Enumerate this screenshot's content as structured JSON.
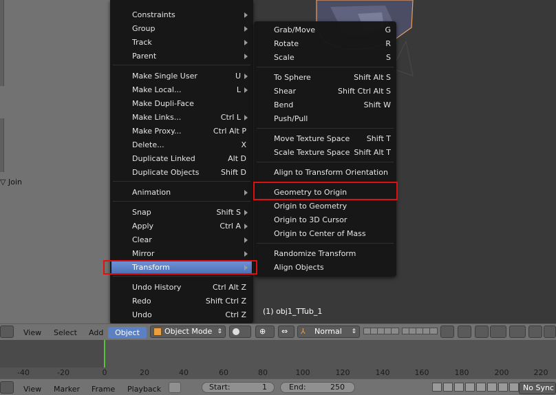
{
  "left_panel": {
    "join_label": "Join"
  },
  "object_menu": {
    "items": [
      {
        "label": "Constraints",
        "shortcut": "",
        "submenu": true
      },
      {
        "label": "Group",
        "shortcut": "",
        "submenu": true
      },
      {
        "label": "Track",
        "shortcut": "",
        "submenu": true
      },
      {
        "label": "Parent",
        "shortcut": "",
        "submenu": true
      },
      {
        "label": "Make Single User",
        "shortcut": "U",
        "submenu": true
      },
      {
        "label": "Make Local...",
        "shortcut": "L",
        "submenu": true
      },
      {
        "label": "Make Dupli-Face",
        "shortcut": "",
        "submenu": false
      },
      {
        "label": "Make Links...",
        "shortcut": "Ctrl L",
        "submenu": true
      },
      {
        "label": "Make Proxy...",
        "shortcut": "Ctrl Alt P",
        "submenu": false
      },
      {
        "label": "Delete...",
        "shortcut": "X",
        "submenu": false
      },
      {
        "label": "Duplicate Linked",
        "shortcut": "Alt D",
        "submenu": false
      },
      {
        "label": "Duplicate Objects",
        "shortcut": "Shift D",
        "submenu": false
      },
      {
        "label": "Animation",
        "shortcut": "",
        "submenu": true
      },
      {
        "label": "Snap",
        "shortcut": "Shift S",
        "submenu": true
      },
      {
        "label": "Apply",
        "shortcut": "Ctrl A",
        "submenu": true
      },
      {
        "label": "Clear",
        "shortcut": "",
        "submenu": true
      },
      {
        "label": "Mirror",
        "shortcut": "",
        "submenu": true
      },
      {
        "label": "Transform",
        "shortcut": "",
        "submenu": true
      },
      {
        "label": "Undo History",
        "shortcut": "Ctrl Alt Z",
        "submenu": false
      },
      {
        "label": "Redo",
        "shortcut": "Shift Ctrl Z",
        "submenu": false
      },
      {
        "label": "Undo",
        "shortcut": "Ctrl Z",
        "submenu": false
      }
    ]
  },
  "transform_menu": {
    "items": [
      {
        "label": "Grab/Move",
        "shortcut": "G"
      },
      {
        "label": "Rotate",
        "shortcut": "R"
      },
      {
        "label": "Scale",
        "shortcut": "S"
      },
      {
        "label": "To Sphere",
        "shortcut": "Shift Alt S"
      },
      {
        "label": "Shear",
        "shortcut": "Shift Ctrl Alt S"
      },
      {
        "label": "Bend",
        "shortcut": "Shift W"
      },
      {
        "label": "Push/Pull",
        "shortcut": ""
      },
      {
        "label": "Move Texture Space",
        "shortcut": "Shift T"
      },
      {
        "label": "Scale Texture Space",
        "shortcut": "Shift Alt T"
      },
      {
        "label": "Align to Transform Orientation",
        "shortcut": ""
      },
      {
        "label": "Geometry to Origin",
        "shortcut": ""
      },
      {
        "label": "Origin to Geometry",
        "shortcut": ""
      },
      {
        "label": "Origin to 3D Cursor",
        "shortcut": ""
      },
      {
        "label": "Origin to Center of Mass",
        "shortcut": ""
      },
      {
        "label": "Randomize Transform",
        "shortcut": ""
      },
      {
        "label": "Align Objects",
        "shortcut": ""
      }
    ]
  },
  "viewport": {
    "info": "(1) obj1_TTub_1"
  },
  "header": {
    "view": "View",
    "select": "Select",
    "add": "Add",
    "object": "Object",
    "mode": "Object Mode",
    "pivot": "Normal"
  },
  "timeline": {
    "ticks": [
      "-40",
      "-20",
      "0",
      "20",
      "40",
      "60",
      "80",
      "100",
      "120",
      "140",
      "160",
      "180",
      "200",
      "220"
    ]
  },
  "footer": {
    "view": "View",
    "marker": "Marker",
    "frame": "Frame",
    "playback": "Playback",
    "start_label": "Start:",
    "start_value": "1",
    "end_label": "End:",
    "end_value": "250",
    "sync": "No Sync"
  },
  "colors": {
    "highlight": "#5b80c4",
    "annotation": "#e01010",
    "menu_bg": "#161616"
  }
}
